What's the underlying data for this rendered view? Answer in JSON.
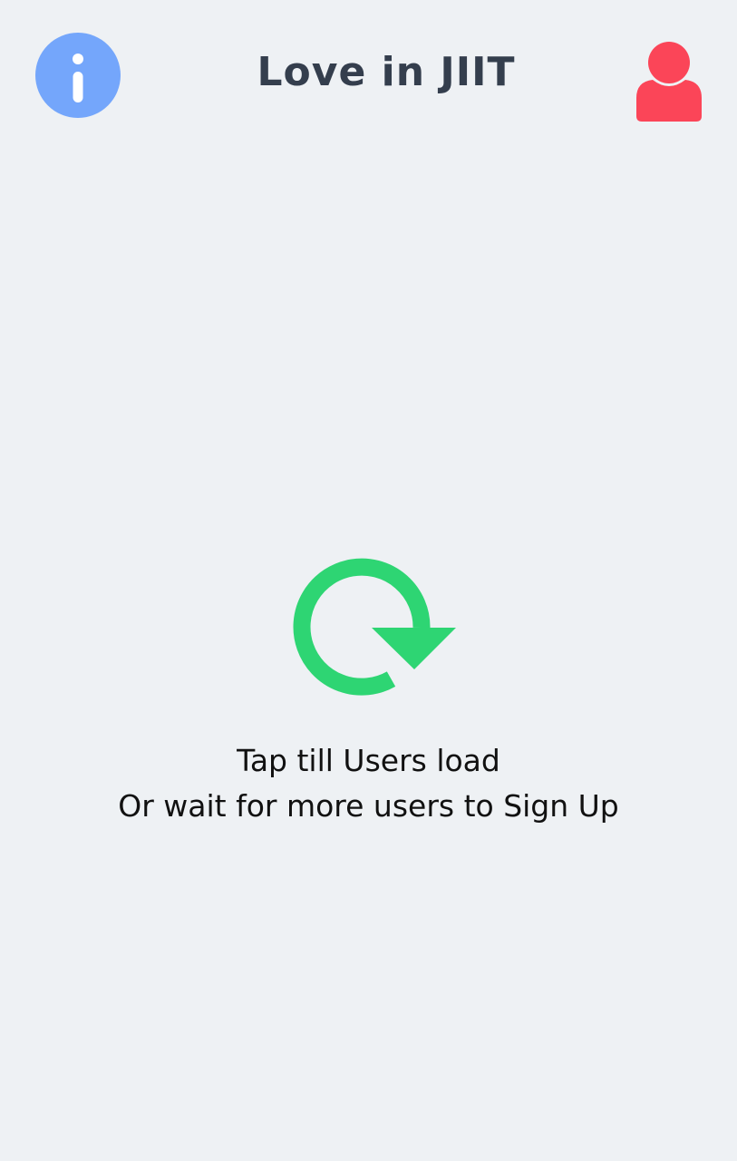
{
  "header": {
    "title": "Love in JIIT",
    "info_icon": "info-icon",
    "profile_icon": "user-profile-icon"
  },
  "main": {
    "refresh_icon": "refresh-icon",
    "message_line1": "Tap till Users load",
    "message_line2": "Or wait for more users to Sign Up"
  },
  "colors": {
    "background": "#eef1f4",
    "info": "#74a6fb",
    "profile": "#fb4558",
    "refresh": "#2ed573",
    "title": "#343e4d"
  }
}
